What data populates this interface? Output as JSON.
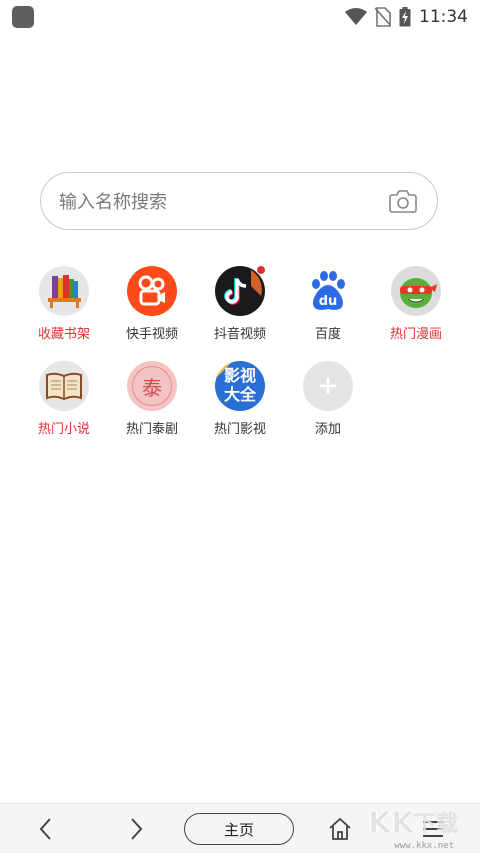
{
  "status_bar": {
    "time": "11:34"
  },
  "search": {
    "placeholder": "输入名称搜索"
  },
  "shortcuts": [
    {
      "label": "收藏书架",
      "icon": "bookshelf-icon",
      "label_color": "red"
    },
    {
      "label": "快手视频",
      "icon": "kuaishou-icon",
      "label_color": "default"
    },
    {
      "label": "抖音视频",
      "icon": "douyin-icon",
      "label_color": "default"
    },
    {
      "label": "百度",
      "icon": "baidu-paw-icon",
      "label_color": "default",
      "icon_text": "du"
    },
    {
      "label": "热门漫画",
      "icon": "ninja-turtle-icon",
      "label_color": "red"
    },
    {
      "label": "热门小说",
      "icon": "open-book-icon",
      "label_color": "red"
    },
    {
      "label": "热门泰剧",
      "icon": "thai-drama-icon",
      "label_color": "default",
      "icon_text": "泰"
    },
    {
      "label": "热门影视",
      "icon": "video-collection-icon",
      "label_color": "default",
      "icon_text": "影视大全"
    },
    {
      "label": "添加",
      "icon": "add-icon",
      "label_color": "default"
    }
  ],
  "bottom_bar": {
    "home_label": "主页"
  },
  "watermark": {
    "text": "www.kkx.net"
  },
  "colors": {
    "red_label": "#e03131",
    "bar_background": "#f5f5f5"
  }
}
